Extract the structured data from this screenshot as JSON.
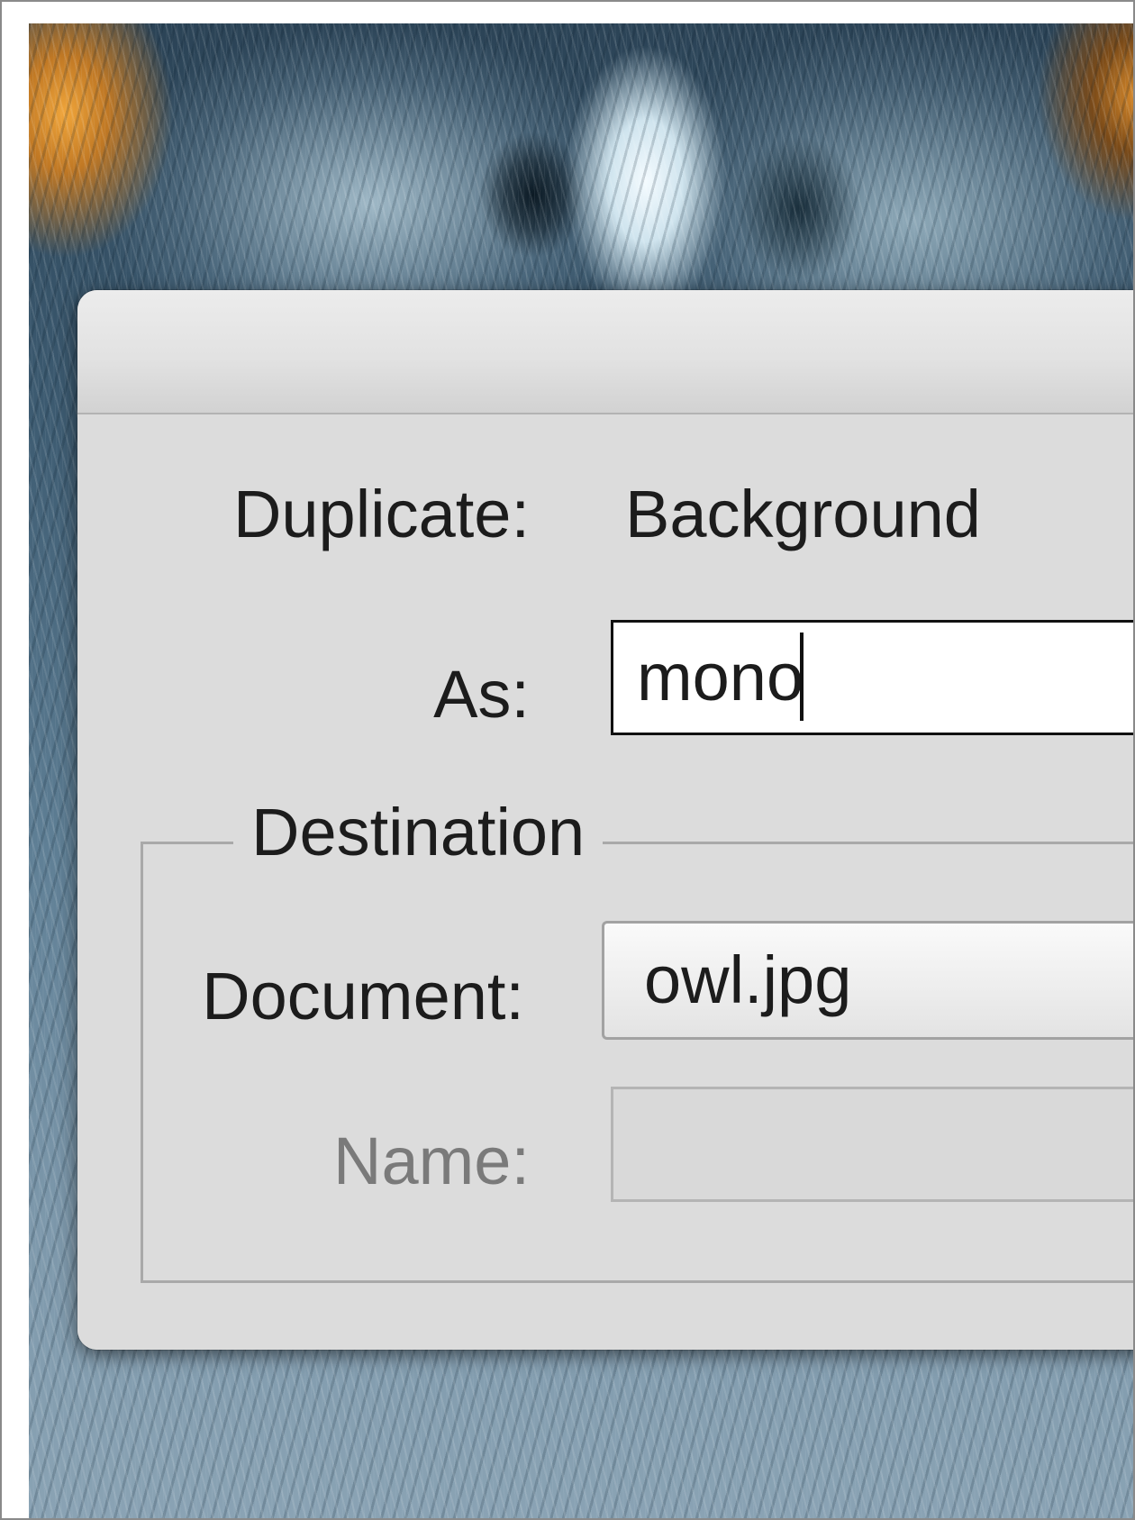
{
  "dialog": {
    "duplicate_label": "Duplicate:",
    "duplicate_value": "Background",
    "as_label": "As:",
    "as_value": "mono",
    "destination": {
      "legend": "Destination",
      "document_label": "Document:",
      "document_value": "owl.jpg",
      "name_label": "Name:",
      "name_value": ""
    }
  },
  "background": {
    "description_icon": "owl-photo"
  },
  "colors": {
    "dialog_bg": "#dcdcdc",
    "field_bg": "#ffffff",
    "disabled_text": "#7a7a7a"
  }
}
